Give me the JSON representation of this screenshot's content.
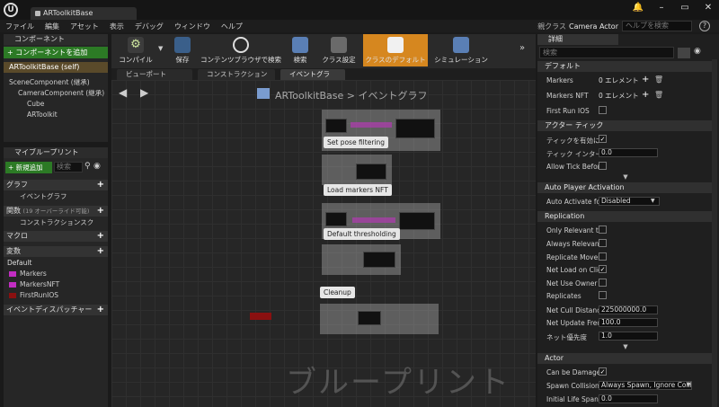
{
  "titlebar": {
    "tab_title": "ARToolkitBase",
    "controls": [
      "🔔",
      "–",
      "▭",
      "✕"
    ]
  },
  "menu": [
    "ファイル",
    "編集",
    "アセット",
    "表示",
    "デバッグ",
    "ウィンドウ",
    "ヘルプ"
  ],
  "parent_class": {
    "label": "親クラス",
    "value": "Camera Actor"
  },
  "help_search_placeholder": "ヘルプを検索",
  "components": {
    "title": "コンポーネント",
    "add_button": "+ コンポーネントを追加",
    "self": "ARToolkitBase (self)",
    "tree": [
      "SceneComponent (継承)",
      "CameraComponent (継承)",
      "Cube",
      "ARToolkit"
    ]
  },
  "my_blueprint": {
    "title": "マイブループリント",
    "new_add": "+ 新規追加",
    "search_placeholder": "検索",
    "graphs_label": "グラフ",
    "event_graph": "イベントグラフ",
    "functions_label": "関数",
    "functions_note": "(19 オーバーライド可能)",
    "construction_script": "コンストラクションスク",
    "macros_label": "マクロ",
    "variables_label": "変数",
    "default_group": "Default",
    "variables": [
      {
        "name": "Markers",
        "color": "#c22dc2"
      },
      {
        "name": "MarkersNFT",
        "color": "#c22dc2"
      },
      {
        "name": "FirstRunIOS",
        "color": "#8a1010"
      }
    ],
    "event_dispatchers": "イベントディスパッチャー"
  },
  "toolbar": {
    "compile": "コンパイル",
    "save": "保存",
    "browse": "コンテンツブラウザで検索",
    "search": "検索",
    "class_settings": "クラス設定",
    "class_defaults": "クラスのデフォルト",
    "simulation": "シミュレーション"
  },
  "graph_tabs": [
    "ビューポート",
    "コンストラクション",
    "イベントグラ"
  ],
  "graph": {
    "breadcrumb_root": "ARToolkitBase",
    "breadcrumb_sep": ">",
    "breadcrumb_leaf": "イベントグラフ",
    "comments": [
      "Set pose filtering",
      "Load markers  NFT",
      "Default thresholding",
      "Cleanup"
    ],
    "watermark": "ブループリント"
  },
  "details": {
    "title": "詳細",
    "search_placeholder": "検索",
    "sections": {
      "default": "デフォルト",
      "actor_tick": "アクター ティック",
      "auto_player": "Auto Player Activation",
      "replication": "Replication",
      "actor": "Actor"
    },
    "default_rows": [
      {
        "label": "Markers",
        "value": "0 エレメント"
      },
      {
        "label": "Markers NFT",
        "value": "0 エレメント"
      },
      {
        "label": "First Run IOS",
        "value": ""
      }
    ],
    "tick_rows": [
      {
        "label": "ティックを有効に",
        "checked": "✓"
      },
      {
        "label": "ティック インター",
        "value": "0.0"
      },
      {
        "label": "Allow Tick Before",
        "checked": ""
      }
    ],
    "auto_activate": {
      "label": "Auto Activate for",
      "value": "Disabled"
    },
    "replication_rows": [
      {
        "label": "Only Relevant to",
        "checked": ""
      },
      {
        "label": "Always Relevant",
        "checked": ""
      },
      {
        "label": "Replicate Movem",
        "checked": ""
      },
      {
        "label": "Net Load on Clier",
        "checked": "✓"
      },
      {
        "label": "Net Use Owner R",
        "checked": ""
      },
      {
        "label": "Replicates",
        "checked": ""
      }
    ],
    "replication_values": [
      {
        "label": "Net Cull Distance",
        "value": "225000000.0"
      },
      {
        "label": "Net Update Frequ",
        "value": "100.0"
      },
      {
        "label": "ネット優先度",
        "value": "1.0"
      }
    ],
    "actor_rows": [
      {
        "label": "Can be Damaged",
        "checked": "✓"
      },
      {
        "label": "Spawn Collision I",
        "value": "Always Spawn, Ignore Collisio"
      },
      {
        "label": "Initial Life Span",
        "value": "0.0"
      }
    ]
  }
}
